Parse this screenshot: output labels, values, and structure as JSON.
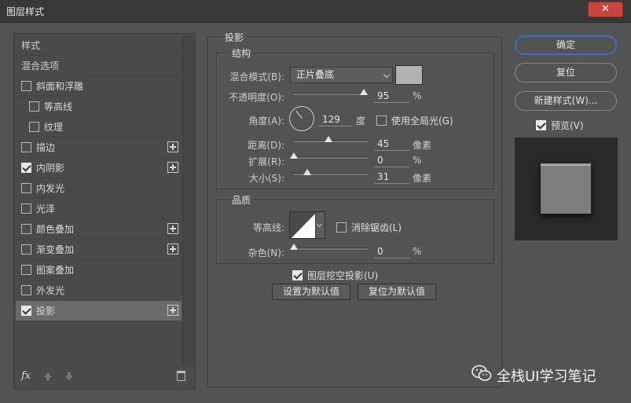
{
  "window": {
    "title": "图层样式",
    "close_label": "✕"
  },
  "left_list": {
    "items": [
      {
        "label": "样式",
        "type": "header"
      },
      {
        "label": "混合选项",
        "type": "header"
      },
      {
        "label": "斜面和浮雕",
        "checked": false,
        "plus": false,
        "sub": false
      },
      {
        "label": "等高线",
        "checked": false,
        "plus": false,
        "sub": true
      },
      {
        "label": "纹理",
        "checked": false,
        "plus": false,
        "sub": true
      },
      {
        "label": "描边",
        "checked": false,
        "plus": true,
        "sub": false
      },
      {
        "label": "内阴影",
        "checked": true,
        "plus": true,
        "sub": false
      },
      {
        "label": "内发光",
        "checked": false,
        "plus": false,
        "sub": false
      },
      {
        "label": "光泽",
        "checked": false,
        "plus": false,
        "sub": false
      },
      {
        "label": "颜色叠加",
        "checked": false,
        "plus": true,
        "sub": false
      },
      {
        "label": "渐变叠加",
        "checked": false,
        "plus": true,
        "sub": false
      },
      {
        "label": "图案叠加",
        "checked": false,
        "plus": false,
        "sub": false
      },
      {
        "label": "外发光",
        "checked": false,
        "plus": false,
        "sub": false
      },
      {
        "label": "投影",
        "checked": true,
        "plus": true,
        "sub": false,
        "selected": true
      }
    ],
    "footer": {
      "fx_label": "fx"
    }
  },
  "drop_shadow": {
    "section_title": "投影",
    "structure": {
      "title": "结构",
      "blend_mode_label": "混合模式(B):",
      "blend_mode_value": "正片叠底",
      "shadow_color": "#b2b2b2",
      "opacity_label": "不透明度(O):",
      "opacity_value": "95",
      "opacity_unit": "%",
      "angle_label": "角度(A):",
      "angle_value": "129",
      "angle_unit": "度",
      "global_light_label": "使用全局光(G)",
      "global_light_checked": false,
      "distance_label": "距离(D):",
      "distance_value": "45",
      "distance_unit": "像素",
      "spread_label": "扩展(R):",
      "spread_value": "0",
      "spread_unit": "%",
      "size_label": "大小(S):",
      "size_value": "31",
      "size_unit": "像素"
    },
    "quality": {
      "title": "品质",
      "contour_label": "等高线:",
      "antialias_label": "消除锯齿(L)",
      "antialias_checked": false,
      "noise_label": "杂色(N):",
      "noise_value": "0",
      "noise_unit": "%"
    },
    "knockout_label": "图层挖空投影(U)",
    "knockout_checked": true,
    "make_default_label": "设置为默认值",
    "reset_default_label": "复位为默认值"
  },
  "right_buttons": {
    "ok": "确定",
    "reset": "复位",
    "new_style": "新建样式(W)...",
    "preview_label": "预览(V)",
    "preview_checked": true
  },
  "watermark": {
    "text": "全栈UI学习笔记"
  }
}
